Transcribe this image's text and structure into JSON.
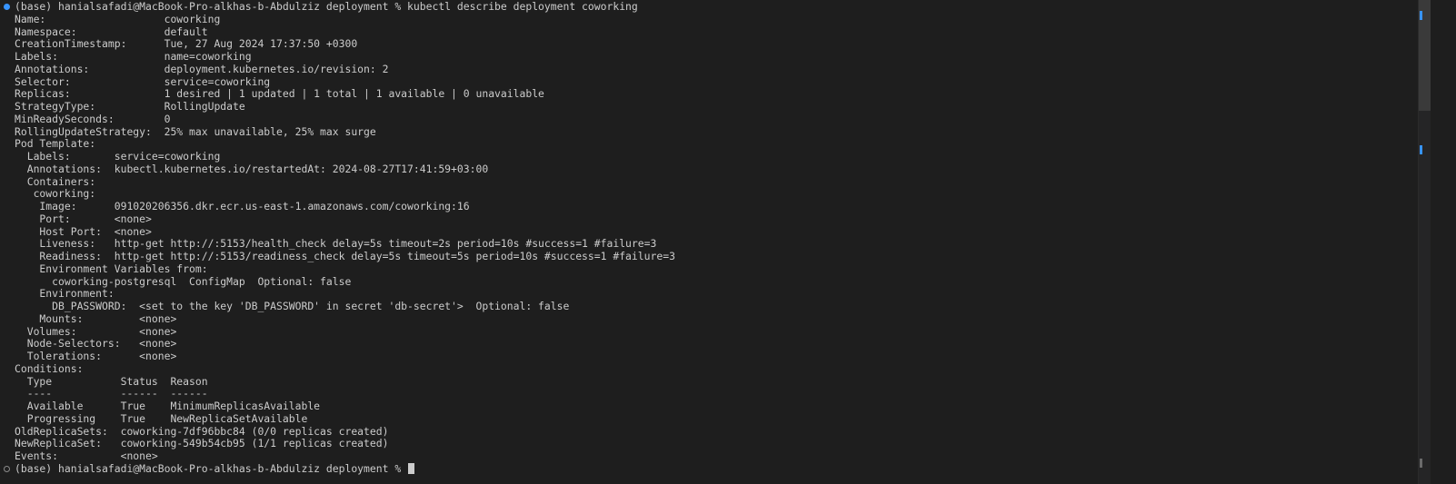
{
  "terminal": {
    "lines": [
      {
        "text": "(base) hanialsafadi@MacBook-Pro-alkhas-b-Abdulziz deployment % kubectl describe deployment coworking",
        "marker": "filled"
      },
      {
        "text": "Name:                   coworking"
      },
      {
        "text": "Namespace:              default"
      },
      {
        "text": "CreationTimestamp:      Tue, 27 Aug 2024 17:37:50 +0300"
      },
      {
        "text": "Labels:                 name=coworking"
      },
      {
        "text": "Annotations:            deployment.kubernetes.io/revision: 2"
      },
      {
        "text": "Selector:               service=coworking"
      },
      {
        "text": "Replicas:               1 desired | 1 updated | 1 total | 1 available | 0 unavailable"
      },
      {
        "text": "StrategyType:           RollingUpdate"
      },
      {
        "text": "MinReadySeconds:        0"
      },
      {
        "text": "RollingUpdateStrategy:  25% max unavailable, 25% max surge"
      },
      {
        "text": "Pod Template:"
      },
      {
        "text": "  Labels:       service=coworking"
      },
      {
        "text": "  Annotations:  kubectl.kubernetes.io/restartedAt: 2024-08-27T17:41:59+03:00"
      },
      {
        "text": "  Containers:"
      },
      {
        "text": "   coworking:"
      },
      {
        "text": "    Image:      091020206356.dkr.ecr.us-east-1.amazonaws.com/coworking:16"
      },
      {
        "text": "    Port:       <none>"
      },
      {
        "text": "    Host Port:  <none>"
      },
      {
        "text": "    Liveness:   http-get http://:5153/health_check delay=5s timeout=2s period=10s #success=1 #failure=3"
      },
      {
        "text": "    Readiness:  http-get http://:5153/readiness_check delay=5s timeout=5s period=10s #success=1 #failure=3"
      },
      {
        "text": "    Environment Variables from:"
      },
      {
        "text": "      coworking-postgresql  ConfigMap  Optional: false"
      },
      {
        "text": "    Environment:"
      },
      {
        "text": "      DB_PASSWORD:  <set to the key 'DB_PASSWORD' in secret 'db-secret'>  Optional: false"
      },
      {
        "text": "    Mounts:         <none>"
      },
      {
        "text": "  Volumes:          <none>"
      },
      {
        "text": "  Node-Selectors:   <none>"
      },
      {
        "text": "  Tolerations:      <none>"
      },
      {
        "text": "Conditions:"
      },
      {
        "text": "  Type           Status  Reason"
      },
      {
        "text": "  ----           ------  ------"
      },
      {
        "text": "  Available      True    MinimumReplicasAvailable"
      },
      {
        "text": "  Progressing    True    NewReplicaSetAvailable"
      },
      {
        "text": "OldReplicaSets:  coworking-7df96bbc84 (0/0 replicas created)"
      },
      {
        "text": "NewReplicaSet:   coworking-549b54cb95 (1/1 replicas created)"
      },
      {
        "text": "Events:          <none>"
      },
      {
        "text": "(base) hanialsafadi@MacBook-Pro-alkhas-b-Abdulziz deployment % ",
        "marker": "hollow",
        "cursor": true
      }
    ]
  },
  "colors": {
    "background": "#1e1e1e",
    "foreground": "#cccccc",
    "accent": "#3794ff"
  }
}
